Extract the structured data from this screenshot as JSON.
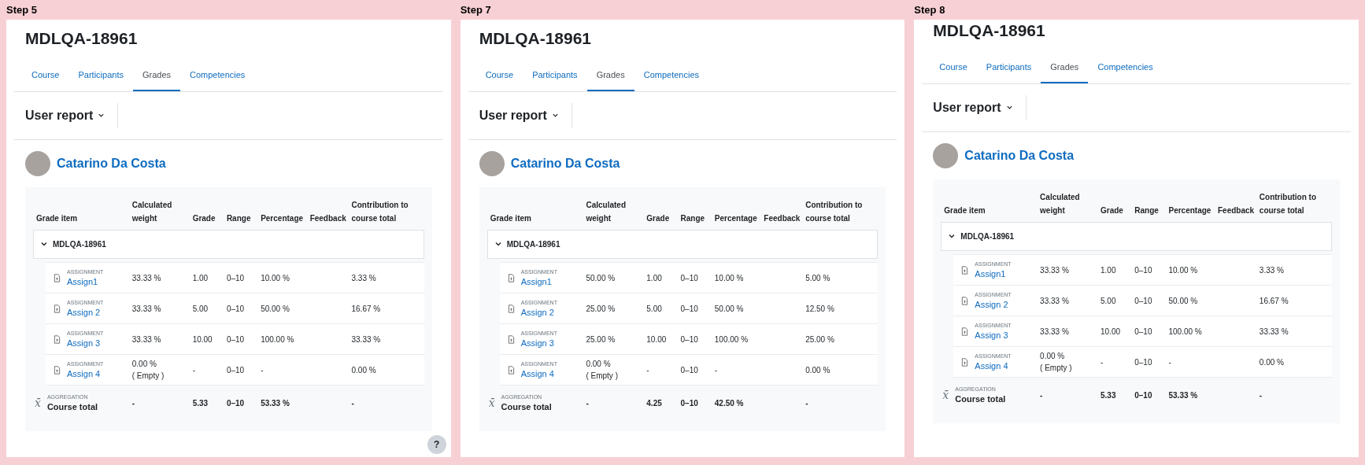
{
  "panels": [
    {
      "step": "Step 5",
      "course_title": "MDLQA-18961",
      "tabs": [
        {
          "label": "Course",
          "selected": false
        },
        {
          "label": "Participants",
          "selected": false
        },
        {
          "label": "Grades",
          "selected": true
        },
        {
          "label": "Competencies",
          "selected": false
        }
      ],
      "report_selector": "User report",
      "user_name": "Catarino Da Costa",
      "columns": [
        "Grade item",
        "Calculated weight",
        "Grade",
        "Range",
        "Percentage",
        "Feedback",
        "Contribution to course total"
      ],
      "category": {
        "name": "MDLQA-18961",
        "expanded": true
      },
      "rows": [
        {
          "type_label": "ASSIGNMENT",
          "name": "Assign1",
          "weight": "33.33 %",
          "grade": "1.00",
          "range": "0–10",
          "percentage": "10.00 %",
          "contribution": "3.33 %"
        },
        {
          "type_label": "ASSIGNMENT",
          "name": "Assign 2",
          "weight": "33.33 %",
          "grade": "5.00",
          "range": "0–10",
          "percentage": "50.00 %",
          "contribution": "16.67 %"
        },
        {
          "type_label": "ASSIGNMENT",
          "name": "Assign 3",
          "weight": "33.33 %",
          "grade": "10.00",
          "range": "0–10",
          "percentage": "100.00 %",
          "contribution": "33.33 %"
        },
        {
          "type_label": "ASSIGNMENT",
          "name": "Assign 4",
          "weight": "0.00 %",
          "weight_note": "( Empty )",
          "grade": "-",
          "range": "0–10",
          "percentage": "-",
          "contribution": "0.00 %"
        }
      ],
      "total": {
        "type_label": "AGGREGATION",
        "icon": "x̄",
        "name": "Course total",
        "weight": "-",
        "grade": "5.33",
        "range": "0–10",
        "percentage": "53.33 %",
        "contribution": "-"
      },
      "help_button": {
        "label": "?"
      }
    },
    {
      "step": "Step 7",
      "course_title": "MDLQA-18961",
      "tabs": [
        {
          "label": "Course",
          "selected": false
        },
        {
          "label": "Participants",
          "selected": false
        },
        {
          "label": "Grades",
          "selected": true
        },
        {
          "label": "Competencies",
          "selected": false
        }
      ],
      "report_selector": "User report",
      "user_name": "Catarino Da Costa",
      "columns": [
        "Grade item",
        "Calculated weight",
        "Grade",
        "Range",
        "Percentage",
        "Feedback",
        "Contribution to course total"
      ],
      "category": {
        "name": "MDLQA-18961",
        "expanded": true
      },
      "rows": [
        {
          "type_label": "ASSIGNMENT",
          "name": "Assign1",
          "weight": "50.00 %",
          "grade": "1.00",
          "range": "0–10",
          "percentage": "10.00 %",
          "contribution": "5.00 %"
        },
        {
          "type_label": "ASSIGNMENT",
          "name": "Assign 2",
          "weight": "25.00 %",
          "grade": "5.00",
          "range": "0–10",
          "percentage": "50.00 %",
          "contribution": "12.50 %"
        },
        {
          "type_label": "ASSIGNMENT",
          "name": "Assign 3",
          "weight": "25.00 %",
          "grade": "10.00",
          "range": "0–10",
          "percentage": "100.00 %",
          "contribution": "25.00 %"
        },
        {
          "type_label": "ASSIGNMENT",
          "name": "Assign 4",
          "weight": "0.00 %",
          "weight_note": "( Empty )",
          "grade": "-",
          "range": "0–10",
          "percentage": "-",
          "contribution": "0.00 %"
        }
      ],
      "total": {
        "type_label": "AGGREGATION",
        "icon": "x̄",
        "name": "Course total",
        "weight": "-",
        "grade": "4.25",
        "range": "0–10",
        "percentage": "42.50 %",
        "contribution": "-"
      }
    },
    {
      "step": "Step 8",
      "course_title": "MDLQA-18961",
      "tabs": [
        {
          "label": "Course",
          "selected": false
        },
        {
          "label": "Participants",
          "selected": false
        },
        {
          "label": "Grades",
          "selected": true
        },
        {
          "label": "Competencies",
          "selected": false
        }
      ],
      "report_selector": "User report",
      "user_name": "Catarino Da Costa",
      "columns": [
        "Grade item",
        "Calculated weight",
        "Grade",
        "Range",
        "Percentage",
        "Feedback",
        "Contribution to course total"
      ],
      "category": {
        "name": "MDLQA-18961",
        "expanded": true
      },
      "rows": [
        {
          "type_label": "ASSIGNMENT",
          "name": "Assign1",
          "weight": "33.33 %",
          "grade": "1.00",
          "range": "0–10",
          "percentage": "10.00 %",
          "contribution": "3.33 %"
        },
        {
          "type_label": "ASSIGNMENT",
          "name": "Assign 2",
          "weight": "33.33 %",
          "grade": "5.00",
          "range": "0–10",
          "percentage": "50.00 %",
          "contribution": "16.67 %"
        },
        {
          "type_label": "ASSIGNMENT",
          "name": "Assign 3",
          "weight": "33.33 %",
          "grade": "10.00",
          "range": "0–10",
          "percentage": "100.00 %",
          "contribution": "33.33 %"
        },
        {
          "type_label": "ASSIGNMENT",
          "name": "Assign 4",
          "weight": "0.00 %",
          "weight_note": "( Empty )",
          "grade": "-",
          "range": "0–10",
          "percentage": "-",
          "contribution": "0.00 %"
        }
      ],
      "total": {
        "type_label": "AGGREGATION",
        "icon": "x̄",
        "name": "Course total",
        "weight": "-",
        "grade": "5.33",
        "range": "0–10",
        "percentage": "53.33 %",
        "contribution": "-"
      }
    }
  ]
}
